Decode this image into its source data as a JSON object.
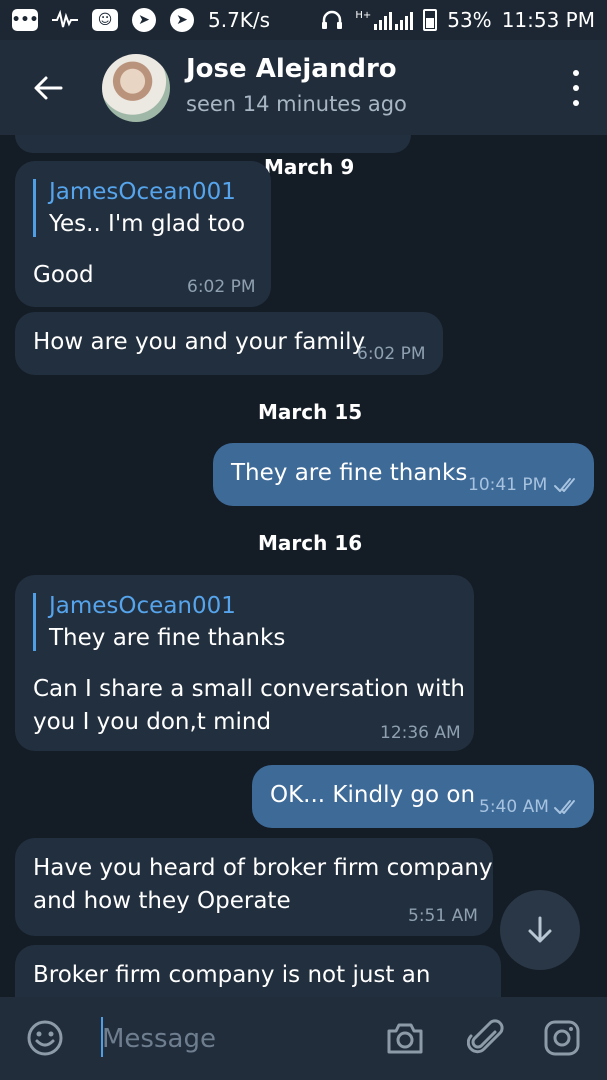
{
  "status_bar": {
    "speed": "5.7K/s",
    "network": "H+",
    "battery": "53%",
    "time": "11:53 PM"
  },
  "header": {
    "name": "Jose Alejandro",
    "status": "seen 14 minutes ago"
  },
  "messages": [
    {
      "type": "date",
      "text": "March 9"
    },
    {
      "type": "in",
      "reply_name": "JamesOcean001",
      "reply_text": "Yes..  I'm glad too",
      "text": "Good",
      "time": "6:02 PM"
    },
    {
      "type": "in",
      "text": "How are you and your family",
      "time": "6:02 PM"
    },
    {
      "type": "date",
      "text": "March 15"
    },
    {
      "type": "out",
      "text": "They are fine thanks",
      "time": "10:41 PM",
      "read": true
    },
    {
      "type": "date",
      "text": "March 16"
    },
    {
      "type": "in",
      "reply_name": "JamesOcean001",
      "reply_text": "They are fine thanks",
      "text_line1": "Can I share a small  conversation with",
      "text_line2": "you I you don,t mind",
      "time": "12:36 AM"
    },
    {
      "type": "out",
      "text": "OK... Kindly go on",
      "time": "5:40 AM",
      "read": true
    },
    {
      "type": "in",
      "text_line1": "Have you heard of broker firm company",
      "text_line2": "and how they Operate",
      "time": "5:51 AM"
    },
    {
      "type": "in",
      "text": "Broker firm company is not just an"
    }
  ],
  "input": {
    "placeholder": "Message"
  },
  "colors": {
    "background": "#141c26",
    "header": "#212d3b",
    "incoming_bubble": "#222f3e",
    "outgoing_bubble": "#3e6a98",
    "accent": "#56a4ec"
  },
  "icons": [
    "back-arrow-icon",
    "more-vert-icon",
    "scroll-down-icon",
    "emoji-icon",
    "camera-icon",
    "attach-icon",
    "instagram-icon"
  ]
}
